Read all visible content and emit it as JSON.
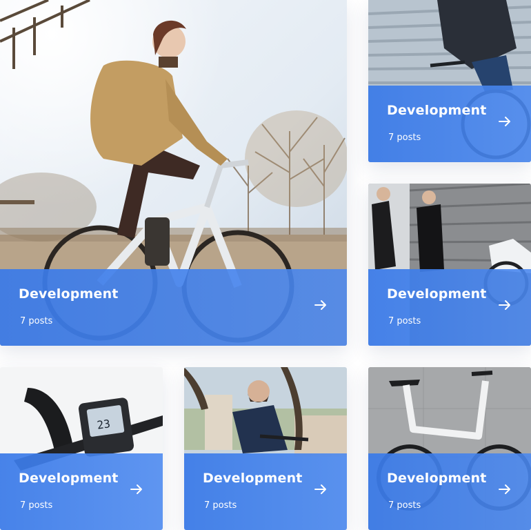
{
  "cards": [
    {
      "title": "Development",
      "count": "7 posts",
      "image": "woman-riding-e-bike-photo"
    },
    {
      "title": "Development",
      "count": "7 posts",
      "image": "man-in-suit-riding-bike-photo"
    },
    {
      "title": "Development",
      "count": "7 posts",
      "image": "people-standing-by-wall-with-bike-photo"
    },
    {
      "title": "Development",
      "count": "7 posts",
      "image": "bike-display-closeup-photo"
    },
    {
      "title": "Development",
      "count": "7 posts",
      "image": "bearded-man-cycling-photo"
    },
    {
      "title": "Development",
      "count": "7 posts",
      "image": "folding-e-bike-concrete-wall-photo"
    }
  ],
  "icons": {
    "arrow": "arrow-right-icon"
  },
  "colors": {
    "overlay_blue": "#3a7ae8",
    "text": "#ffffff"
  }
}
